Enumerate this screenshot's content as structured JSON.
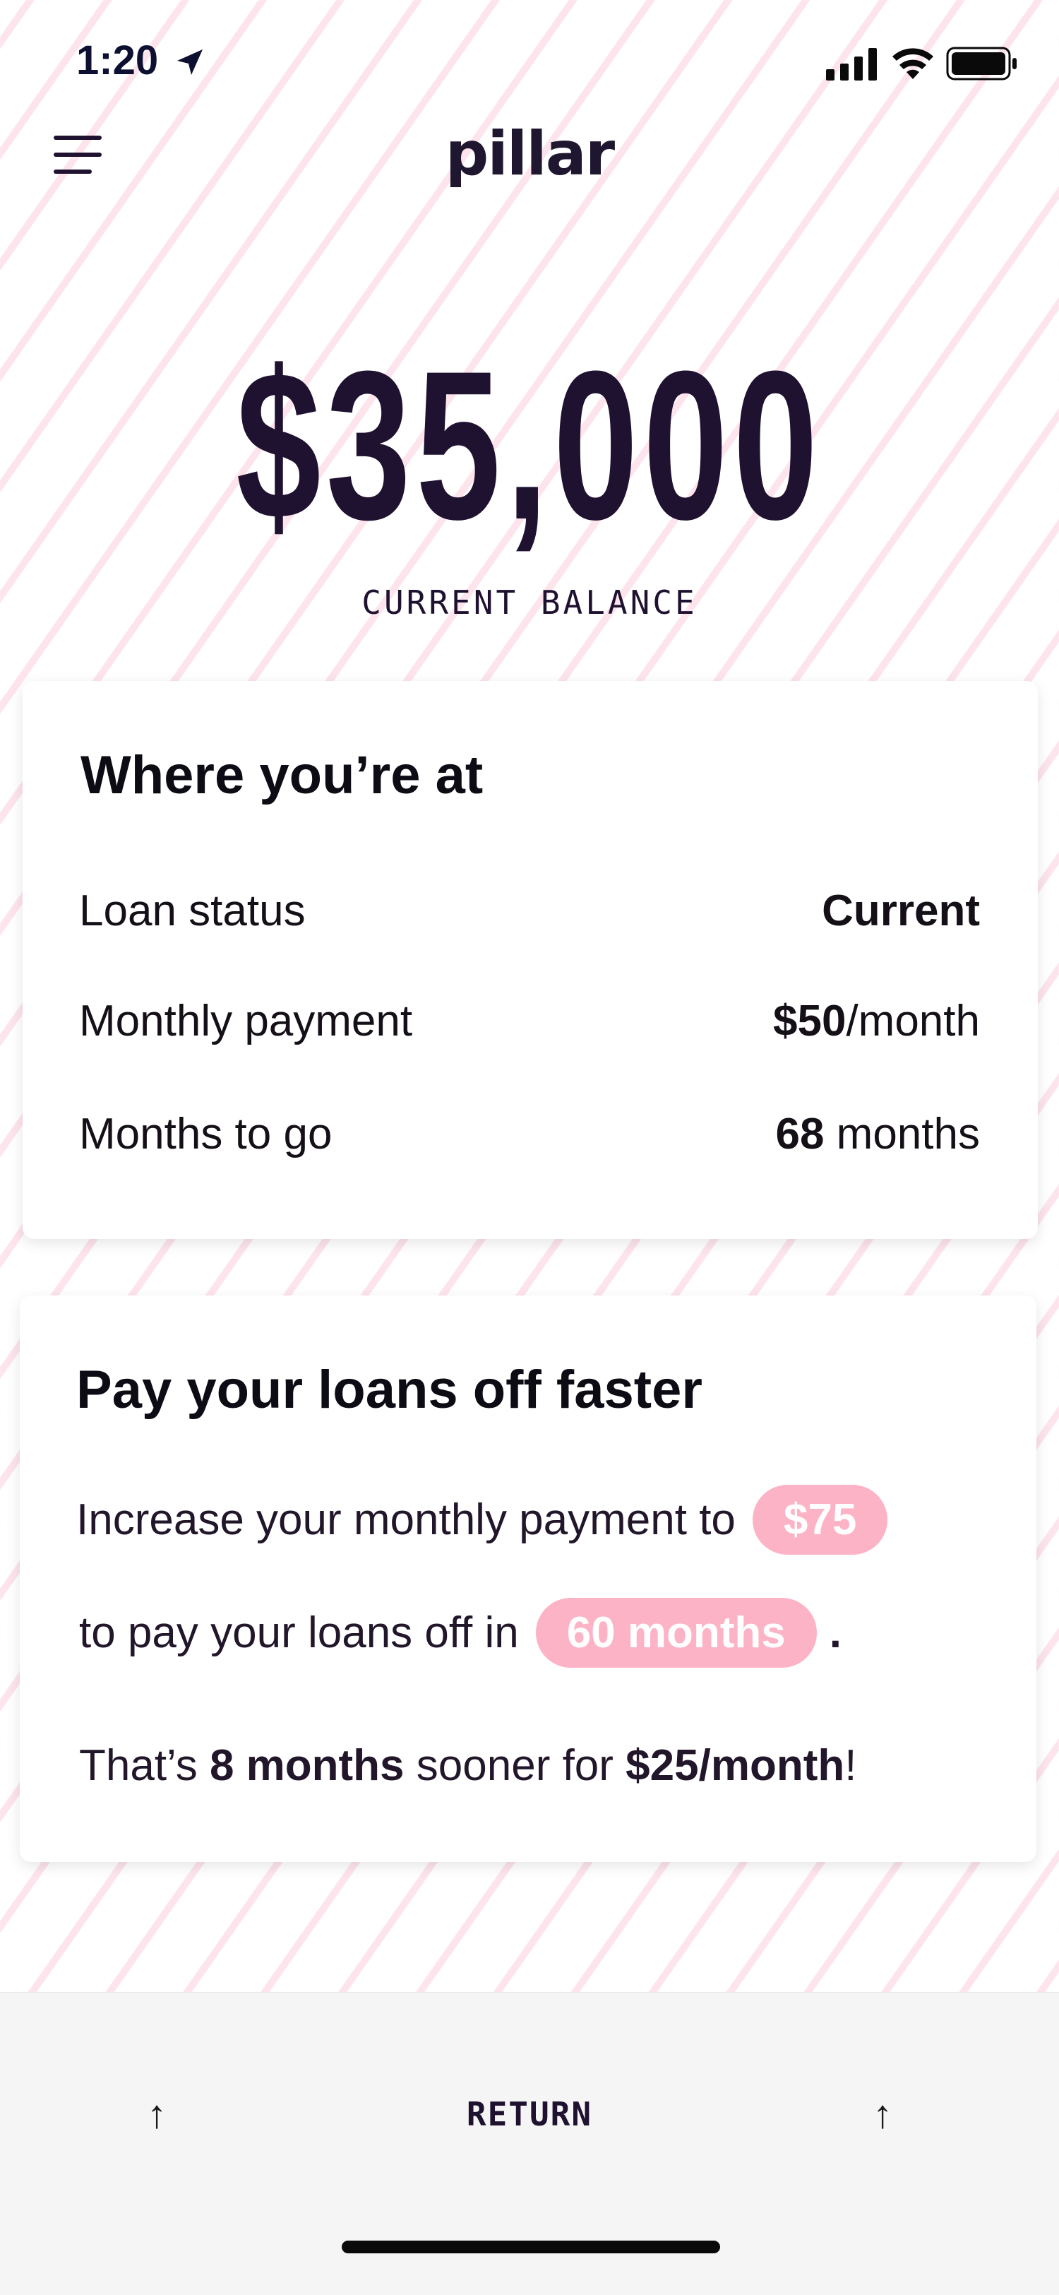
{
  "status_bar": {
    "time": "1:20"
  },
  "header": {
    "logo": "pillar"
  },
  "balance": {
    "amount": "$35,000",
    "label": "CURRENT BALANCE"
  },
  "where_card": {
    "title": "Where you’re at",
    "rows": [
      {
        "label": "Loan status",
        "value_bold": "Current",
        "value_rest": ""
      },
      {
        "label": "Monthly payment",
        "value_bold": "$50",
        "value_rest": "/month"
      },
      {
        "label": "Months to go",
        "value_bold": "68",
        "value_rest": " months"
      }
    ]
  },
  "faster_card": {
    "title": "Pay your loans off faster",
    "line1_text": "Increase your monthly payment to",
    "payment_pill": "$75",
    "line2_text": "to pay your loans off in",
    "months_pill": "60 months",
    "line2_end": ".",
    "line3_a": "That’s ",
    "line3_b": "8 months",
    "line3_c": " sooner for ",
    "line3_d": "$25/month",
    "line3_e": "!"
  },
  "bottom_bar": {
    "return_label": "RETURN",
    "left_arrow": "↑",
    "right_arrow": "↑"
  },
  "colors": {
    "accent_pink": "#fdb3c6",
    "text_dark": "#1f1130"
  }
}
